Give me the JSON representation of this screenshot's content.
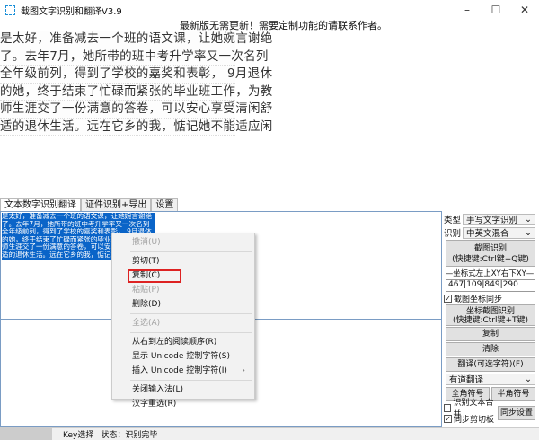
{
  "window": {
    "title": "截图文字识别和翻译V3.9",
    "minimize": "–",
    "maximize": "☐",
    "close": "✕"
  },
  "notice": "最新版无需更新！需要定制功能的请联系作者。",
  "preview_lines": [
    "是太好，准备减去一个班的语文课，让她婉言谢绝",
    "了。去年7月，她所带的班中考升学率又一次名列",
    "全年级前列，得到了学校的嘉奖和表彰， 9月退休",
    "的她，终于结束了忙碌而紧张的毕业班工作，为教",
    "师生涯交了一份满意的答卷，可以安心享受清闲舒",
    "适的退休生活。远在它乡的我，惦记她不能适应闲"
  ],
  "tabs": [
    "文本数字识别翻译",
    "证件识别+导出",
    "设置"
  ],
  "selected_text": [
    "是太好，准备减去一个班的语文课，让她婉言谢绝",
    "了。去年7月，她所带的班中考升学率又一次名列",
    "全年级前列，得到了学校的嘉奖和表彰， 9月退休",
    "的她，终于结束了忙碌而紧张的毕业班工作，为教",
    "师生涯交了一份满意的答卷，可以安心享受清闲舒",
    "适的退休生活。远在它乡的我，惦记她不能适应闲"
  ],
  "context_menu": {
    "undo": "撤消(U)",
    "cut": "剪切(T)",
    "copy": "复制(C)",
    "paste": "粘贴(P)",
    "delete": "删除(D)",
    "select_all": "全选(A)",
    "rtl": "从右到左的阅读顺序(R)",
    "show_unicode": "显示 Unicode 控制字符(S)",
    "insert_unicode": "插入 Unicode 控制字符(I)",
    "close_ime": "关闭输入法(L)",
    "reconvert": "汉字重选(R)"
  },
  "side": {
    "type_label": "类型",
    "type_value": "手写文字识别",
    "lang_label": "识别",
    "lang_value": "中英文混合",
    "capture_btn": [
      "截图识别",
      "(快捷键:Ctrl键+Q键)"
    ],
    "coord_label": "—坐标式左上XY右下XY—",
    "coord_value": "467|109|849|290",
    "sync_check": "截图坐标同步",
    "coord_capture_btn": [
      "坐标截图识别",
      "(快捷键:Ctrl键+T键)"
    ],
    "copy": "复制",
    "clear": "清除",
    "translate": "翻译(可选字符)(F)",
    "engine": "有道翻译",
    "fullwidth": "全角符号",
    "halfwidth": "半角符号",
    "merge_check": "识别文本合并",
    "sync_clip_check": "同步剪切板",
    "sync_settings": "同步设置"
  },
  "status": {
    "key": "Key选择",
    "state": "状态：识别完毕"
  }
}
